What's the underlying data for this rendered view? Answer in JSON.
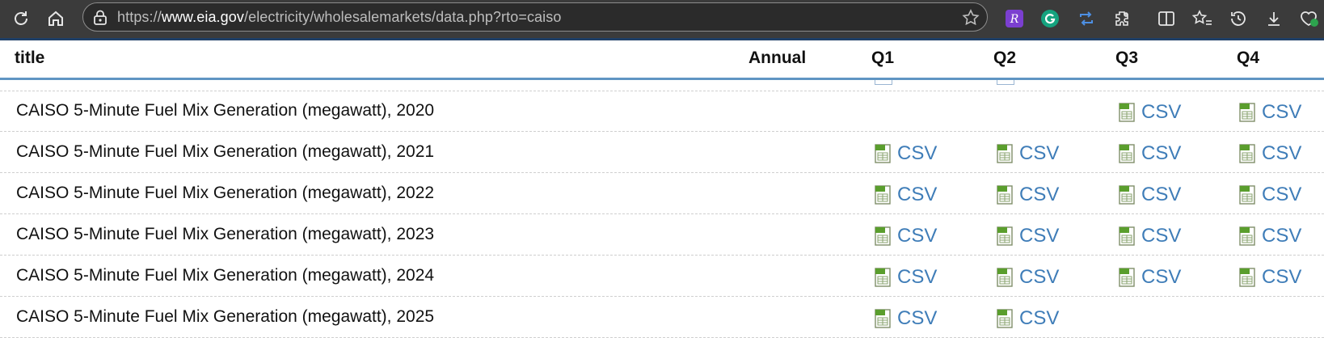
{
  "browser": {
    "url_prefix": "https://",
    "url_host": "www.eia.gov",
    "url_path": "/electricity/wholesalemarkets/data.php?rto=caiso",
    "extensions": [
      "r-extension-icon",
      "grammarly-icon",
      "repeat-icon",
      "puzzle-icon"
    ],
    "colors": {
      "toolbar": "#3b3b3b",
      "accent": "#1f3f66"
    }
  },
  "table": {
    "headers": {
      "title": "title",
      "annual": "Annual",
      "q1": "Q1",
      "q2": "Q2",
      "q3": "Q3",
      "q4": "Q4"
    },
    "link_label": "CSV",
    "link_color": "#3f7db8",
    "rows": [
      {
        "title": "CAISO 5-Minute Fuel Mix Generation (megawatt), 2020",
        "annual": "",
        "q1": "",
        "q2": "",
        "q3": "CSV",
        "q4": "CSV"
      },
      {
        "title": "CAISO 5-Minute Fuel Mix Generation (megawatt), 2021",
        "annual": "",
        "q1": "CSV",
        "q2": "CSV",
        "q3": "CSV",
        "q4": "CSV"
      },
      {
        "title": "CAISO 5-Minute Fuel Mix Generation (megawatt), 2022",
        "annual": "",
        "q1": "CSV",
        "q2": "CSV",
        "q3": "CSV",
        "q4": "CSV"
      },
      {
        "title": "CAISO 5-Minute Fuel Mix Generation (megawatt), 2023",
        "annual": "",
        "q1": "CSV",
        "q2": "CSV",
        "q3": "CSV",
        "q4": "CSV"
      },
      {
        "title": "CAISO 5-Minute Fuel Mix Generation (megawatt), 2024",
        "annual": "",
        "q1": "CSV",
        "q2": "CSV",
        "q3": "CSV",
        "q4": "CSV"
      },
      {
        "title": "CAISO 5-Minute Fuel Mix Generation (megawatt), 2025",
        "annual": "",
        "q1": "CSV",
        "q2": "CSV",
        "q3": "",
        "q4": ""
      }
    ]
  }
}
